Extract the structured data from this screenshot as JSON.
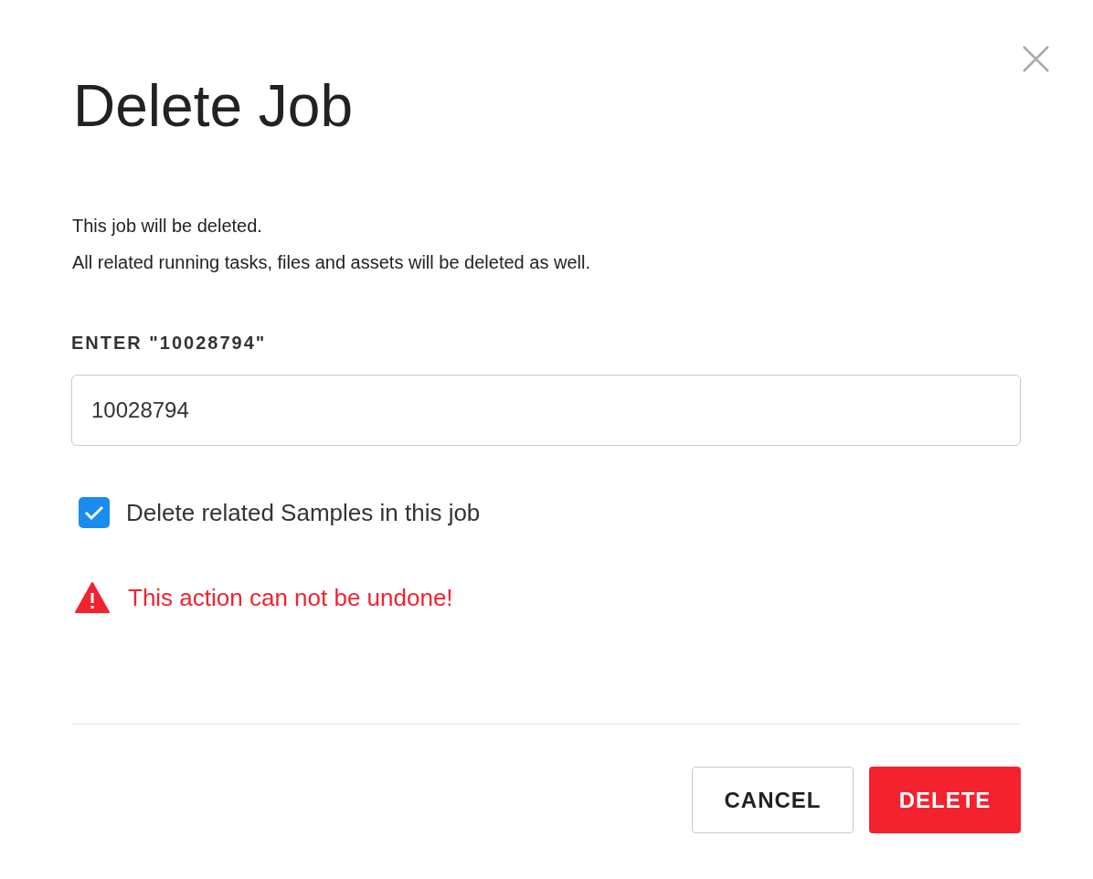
{
  "dialog": {
    "title": "Delete Job",
    "message": [
      "This job will be deleted.",
      "All related running tasks, files and assets will be deleted as well."
    ],
    "confirm_field": {
      "label": "ENTER \"10028794\"",
      "value": "10028794"
    },
    "checkbox": {
      "label": "Delete related Samples in this job",
      "checked": true
    },
    "warning": "This action can not be undone!",
    "buttons": [
      {
        "label": "CANCEL",
        "kind": "secondary"
      },
      {
        "label": "DELETE",
        "kind": "danger"
      }
    ]
  }
}
